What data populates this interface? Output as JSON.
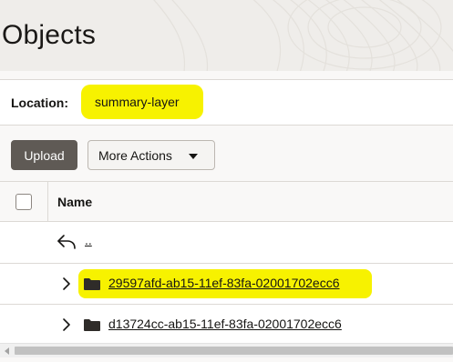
{
  "page": {
    "title": "Objects"
  },
  "location": {
    "label": "Location:",
    "value": "summary-layer"
  },
  "toolbar": {
    "upload_label": "Upload",
    "more_actions_label": "More Actions"
  },
  "table": {
    "columns": [
      {
        "label": "Name"
      }
    ],
    "parent_row": {
      "label": ".."
    },
    "rows": [
      {
        "name": "29597afd-ab15-11ef-83fa-02001702ecc6",
        "type": "folder",
        "highlighted": true
      },
      {
        "name": "d13724cc-ab15-11ef-83fa-02001702ecc6",
        "type": "folder",
        "highlighted": false
      }
    ]
  },
  "icons": {
    "back": "back-arrow-icon",
    "expand": "chevron-right-icon",
    "folder": "folder-icon",
    "dropdown": "caret-down-icon"
  },
  "colors": {
    "highlight": "#f7f200",
    "primary_button": "#5f5a55",
    "header_background": "#efedea",
    "text": "#161513"
  }
}
